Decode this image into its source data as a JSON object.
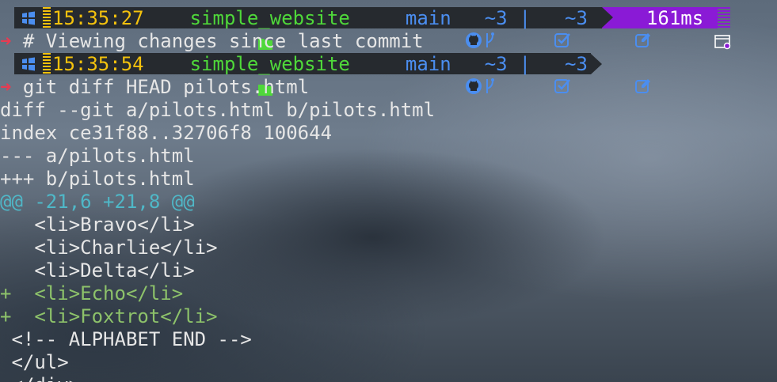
{
  "prompts": [
    {
      "time": "15:35:27",
      "folder": "simple_website",
      "branch": "main",
      "staged": "~3",
      "separator": "|",
      "modified": "~3",
      "exec_time": "161ms"
    },
    {
      "time": "15:35:54",
      "folder": "simple_website",
      "branch": "main",
      "staged": "~3",
      "separator": "|",
      "modified": "~3"
    }
  ],
  "prompt_arrow": "➜",
  "commands": [
    "# Viewing changes since last commit",
    "git diff HEAD pilots.html"
  ],
  "output": [
    "diff --git a/pilots.html b/pilots.html",
    "index ce31f88..32706f8 100644",
    "--- a/pilots.html",
    "+++ b/pilots.html",
    "@@ -21,6 +21,8 @@",
    "   <li>Bravo</li>",
    "   <li>Charlie</li>",
    "   <li>Delta</li>",
    "+  <li>Echo</li>",
    "+  <li>Foxtrot</li>",
    " <!-- ALPHABET END -->",
    " </ul>",
    " </div>"
  ],
  "colors": {
    "time": "#f4c20d",
    "folder": "#4fd83a",
    "git": "#4b8ef0",
    "exec_bg": "#8a1ad6",
    "arrow": "#e63b52",
    "hunk": "#4fb8c8",
    "added": "#8dc26a"
  },
  "icons": {
    "os": "windows-icon",
    "folder": "folder-icon",
    "github": "github-icon",
    "branch": "git-branch-icon",
    "staged": "checkbox-icon",
    "modified": "edit-icon",
    "exec": "stopwatch-icon"
  }
}
